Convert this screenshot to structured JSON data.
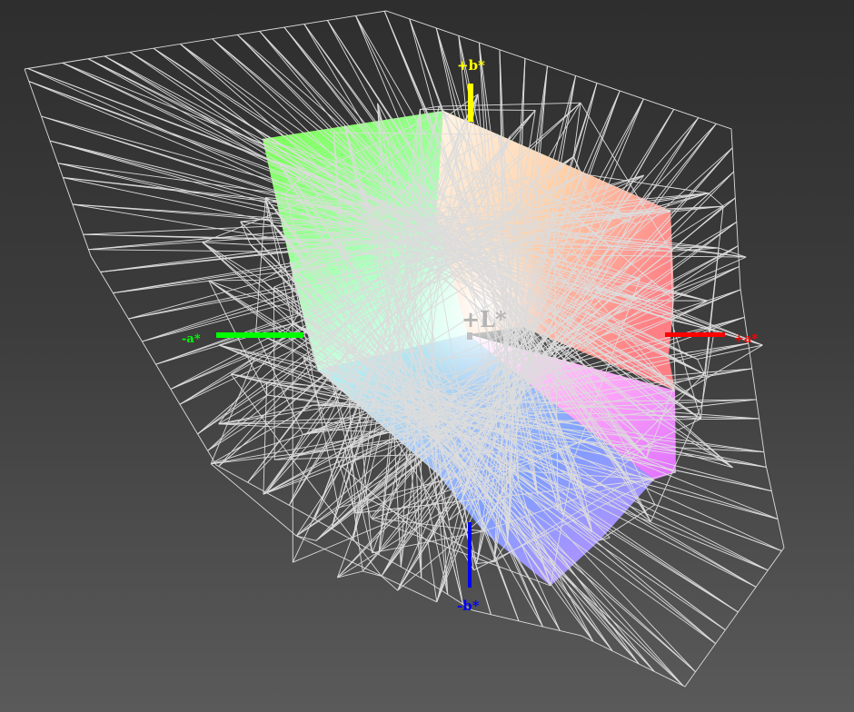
{
  "axes": {
    "pos_b": {
      "label": "+b*",
      "color": "#ffff00"
    },
    "neg_b": {
      "label": "-b*",
      "color": "#0000ff"
    },
    "pos_a": {
      "label": "+a*",
      "color": "#ff0000"
    },
    "neg_a": {
      "label": "-a*",
      "color": "#00ff00"
    },
    "lightness": {
      "label": "+L*",
      "color": "#b4b4b4"
    }
  },
  "colors": {
    "mesh": "#dcdcdc",
    "yellow": "#ffff60",
    "green": "#60ff60",
    "cyan": "#a0ffff",
    "blue": "#6f8fff",
    "magenta": "#ff60ff",
    "red": "#ff7f7f",
    "white": "#ffffff"
  }
}
